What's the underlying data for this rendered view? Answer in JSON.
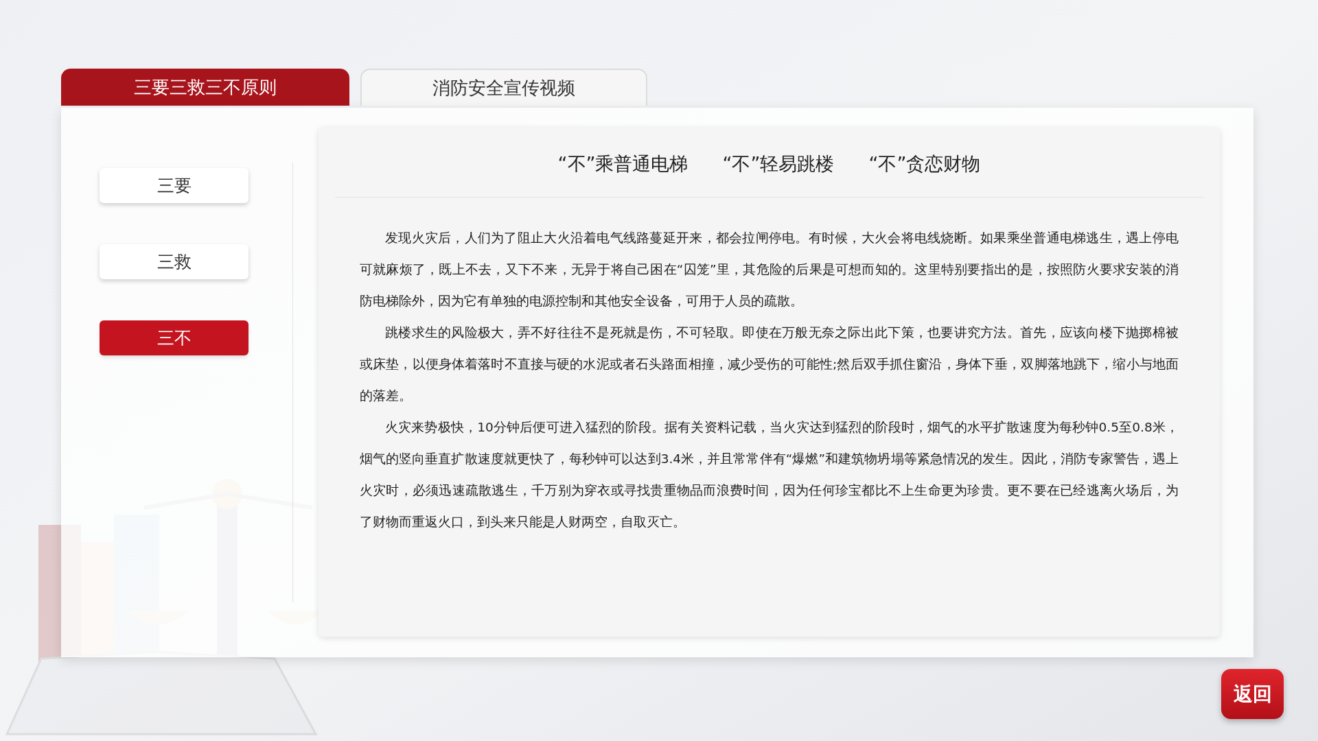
{
  "tabs": [
    {
      "label": "三要三救三不原则",
      "selected": true
    },
    {
      "label": "消防安全宣传视频",
      "selected": false
    }
  ],
  "side_menu": [
    {
      "label": "三要",
      "selected": false
    },
    {
      "label": "三救",
      "selected": false
    },
    {
      "label": "三不",
      "selected": true
    }
  ],
  "content": {
    "headings": [
      "“不”乘普通电梯",
      "“不”轻易跳楼",
      "“不”贪恋财物"
    ],
    "paragraphs": [
      "发现火灾后，人们为了阻止大火沿着电气线路蔓延开来，都会拉闸停电。有时候，大火会将电线烧断。如果乘坐普通电梯逃生，遇上停电可就麻烦了，既上不去，又下不来，无异于将自己困在“囚笼”里，其危险的后果是可想而知的。这里特别要指出的是，按照防火要求安装的消防电梯除外，因为它有单独的电源控制和其他安全设备，可用于人员的疏散。",
      "跳楼求生的风险极大，弄不好往往不是死就是伤，不可轻取。即使在万般无奈之际出此下策，也要讲究方法。首先，应该向楼下抛掷棉被或床垫，以便身体着落时不直接与硬的水泥或者石头路面相撞，减少受伤的可能性;然后双手抓住窗沿，身体下垂，双脚落地跳下，缩小与地面的落差。",
      "火灾来势极快，10分钟后便可进入猛烈的阶段。据有关资料记载，当火灾达到猛烈的阶段时，烟气的水平扩散速度为每秒钟0.5至0.8米，烟气的竖向垂直扩散速度就更快了，每秒钟可以达到3.4米，并且常常伴有“爆燃”和建筑物坍塌等紧急情况的发生。因此，消防专家警告，遇上火灾时，必须迅速疏散逃生，千万别为穿衣或寻找贵重物品而浪费时间，因为任何珍宝都比不上生命更为珍贵。更不要在已经逃离火场后，为了财物而重返火口，到头来只能是人财两空，自取灭亡。"
    ]
  },
  "back_button": "返回"
}
